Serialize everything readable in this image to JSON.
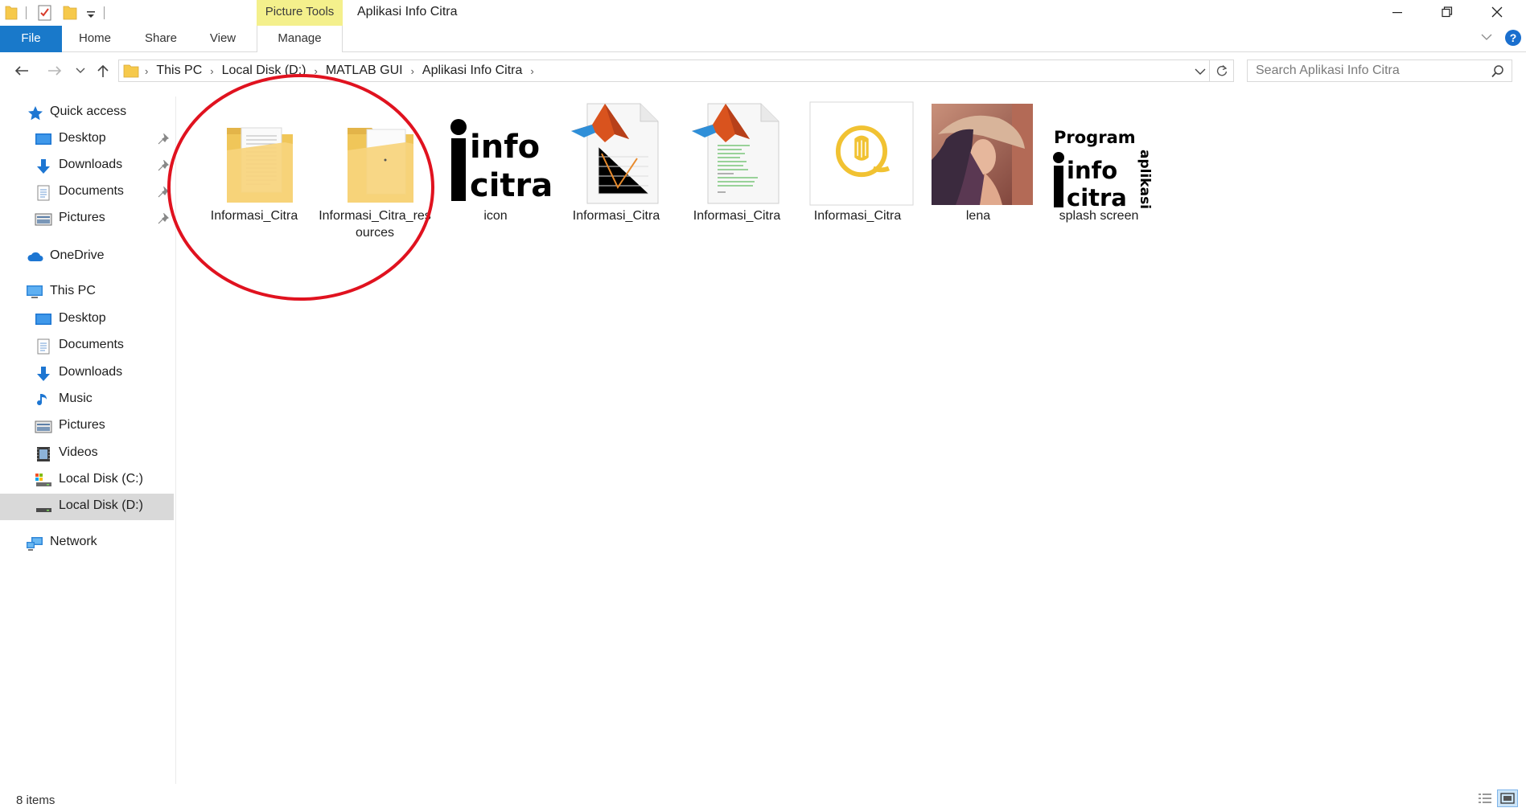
{
  "window": {
    "title": "Aplikasi Info Citra",
    "context_tab": "Picture Tools"
  },
  "ribbon": {
    "tabs": [
      "File",
      "Home",
      "Share",
      "View",
      "Manage"
    ],
    "help": "?"
  },
  "address": {
    "crumbs": [
      "This PC",
      "Local Disk (D:)",
      "MATLAB GUI",
      "Aplikasi Info Citra"
    ]
  },
  "search": {
    "placeholder": "Search Aplikasi Info Citra"
  },
  "sidebar": {
    "quick_access": {
      "label": "Quick access",
      "items": [
        {
          "label": "Desktop",
          "icon": "desktop-icon",
          "pinned": true
        },
        {
          "label": "Downloads",
          "icon": "download-icon",
          "pinned": true
        },
        {
          "label": "Documents",
          "icon": "documents-icon",
          "pinned": true
        },
        {
          "label": "Pictures",
          "icon": "pictures-icon",
          "pinned": true
        }
      ]
    },
    "onedrive": {
      "label": "OneDrive"
    },
    "this_pc": {
      "label": "This PC",
      "items": [
        {
          "label": "Desktop",
          "icon": "desktop-icon"
        },
        {
          "label": "Documents",
          "icon": "documents-icon"
        },
        {
          "label": "Downloads",
          "icon": "download-icon"
        },
        {
          "label": "Music",
          "icon": "music-icon"
        },
        {
          "label": "Pictures",
          "icon": "pictures-icon"
        },
        {
          "label": "Videos",
          "icon": "videos-icon"
        },
        {
          "label": "Local Disk (C:)",
          "icon": "os-drive-icon"
        },
        {
          "label": "Local Disk (D:)",
          "icon": "drive-icon",
          "selected": true
        }
      ]
    },
    "network": {
      "label": "Network"
    }
  },
  "files": [
    {
      "name": "Informasi_Citra",
      "kind": "folder",
      "icon": "folder-with-document-icon"
    },
    {
      "name": "Informasi_Citra_resources",
      "kind": "folder",
      "icon": "folder-icon"
    },
    {
      "name": "icon",
      "kind": "image",
      "icon": "info-citra-logo-thumbnail",
      "logo_text": [
        "info",
        "citra"
      ]
    },
    {
      "name": "Informasi_Citra",
      "kind": "matlab-figure",
      "icon": "matlab-fig-file-icon"
    },
    {
      "name": "Informasi_Citra",
      "kind": "matlab-code",
      "icon": "matlab-m-file-icon"
    },
    {
      "name": "Informasi_Citra",
      "kind": "application",
      "icon": "app-icon"
    },
    {
      "name": "lena",
      "kind": "image",
      "icon": "lena-photo-thumbnail"
    },
    {
      "name": "splash screen",
      "kind": "image",
      "icon": "splash-screen-thumbnail",
      "logo_text": [
        "Program",
        "info",
        "citra",
        "aplikasi"
      ]
    }
  ],
  "status": {
    "item_count": "8 items"
  },
  "colors": {
    "file_tab": "#1979ca",
    "picture_tools": "#f4f08c",
    "highlight": "#e0121f",
    "selected_nav": "#d9d9d9"
  }
}
